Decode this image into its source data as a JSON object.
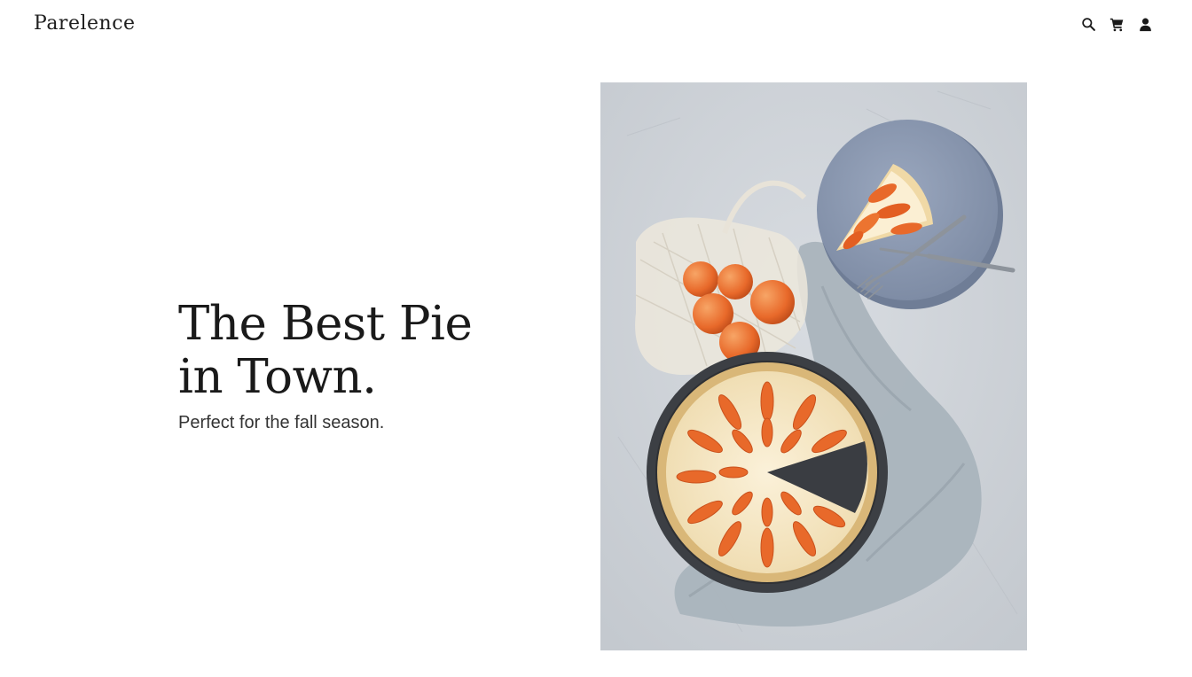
{
  "brand": {
    "name": "Parelence"
  },
  "nav": {
    "icons": [
      "search-icon",
      "cart-icon",
      "account-icon"
    ]
  },
  "hero": {
    "heading_line1": "The Best Pie",
    "heading_line2": "in Town.",
    "subheading": "Perfect for the fall season."
  },
  "colors": {
    "text": "#1a1a1a",
    "background": "#ffffff",
    "apricot": "#e8692a",
    "plate": "#8e9bb4"
  }
}
